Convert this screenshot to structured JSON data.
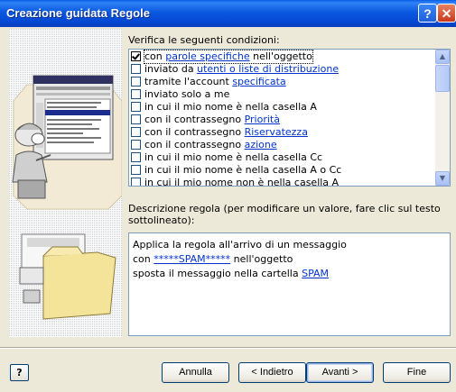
{
  "window": {
    "title": "Creazione guidata Regole"
  },
  "conditions": {
    "heading": "Verifica le seguenti condizioni:",
    "items": [
      {
        "checked": true,
        "before": "con ",
        "link": "parole specifiche",
        "after": " nell'oggetto"
      },
      {
        "checked": false,
        "before": "inviato da ",
        "link": "utenti o liste di distribuzione",
        "after": ""
      },
      {
        "checked": false,
        "before": "tramite l'account ",
        "link": "specificata",
        "after": ""
      },
      {
        "checked": false,
        "before": "inviato solo a me",
        "link": "",
        "after": ""
      },
      {
        "checked": false,
        "before": "in cui il mio nome è nella casella A",
        "link": "",
        "after": ""
      },
      {
        "checked": false,
        "before": "con il contrassegno ",
        "link": "Priorità",
        "after": ""
      },
      {
        "checked": false,
        "before": "con il contrassegno ",
        "link": "Riservatezza",
        "after": ""
      },
      {
        "checked": false,
        "before": "con il contrassegno ",
        "link": "azione",
        "after": ""
      },
      {
        "checked": false,
        "before": "in cui il mio nome è nella casella Cc",
        "link": "",
        "after": ""
      },
      {
        "checked": false,
        "before": "in cui il mio nome è nella casella A o Cc",
        "link": "",
        "after": ""
      },
      {
        "checked": false,
        "before": "in cui il mio nome non è nella casella A",
        "link": "",
        "after": ""
      }
    ]
  },
  "description": {
    "heading_line1": "Descrizione regola (per modificare un valore, fare clic sul testo",
    "heading_line2": "sottolineato):",
    "line1": "Applica la regola all'arrivo di un messaggio",
    "line2_before": "con ",
    "line2_link": "*****SPAM*****",
    "line2_after": " nell'oggetto",
    "line3_before": "sposta il messaggio nella cartella ",
    "line3_link": "SPAM"
  },
  "buttons": {
    "help": "?",
    "cancel": "Annulla",
    "back": "< Indietro",
    "next": "Avanti >",
    "finish": "Fine"
  }
}
